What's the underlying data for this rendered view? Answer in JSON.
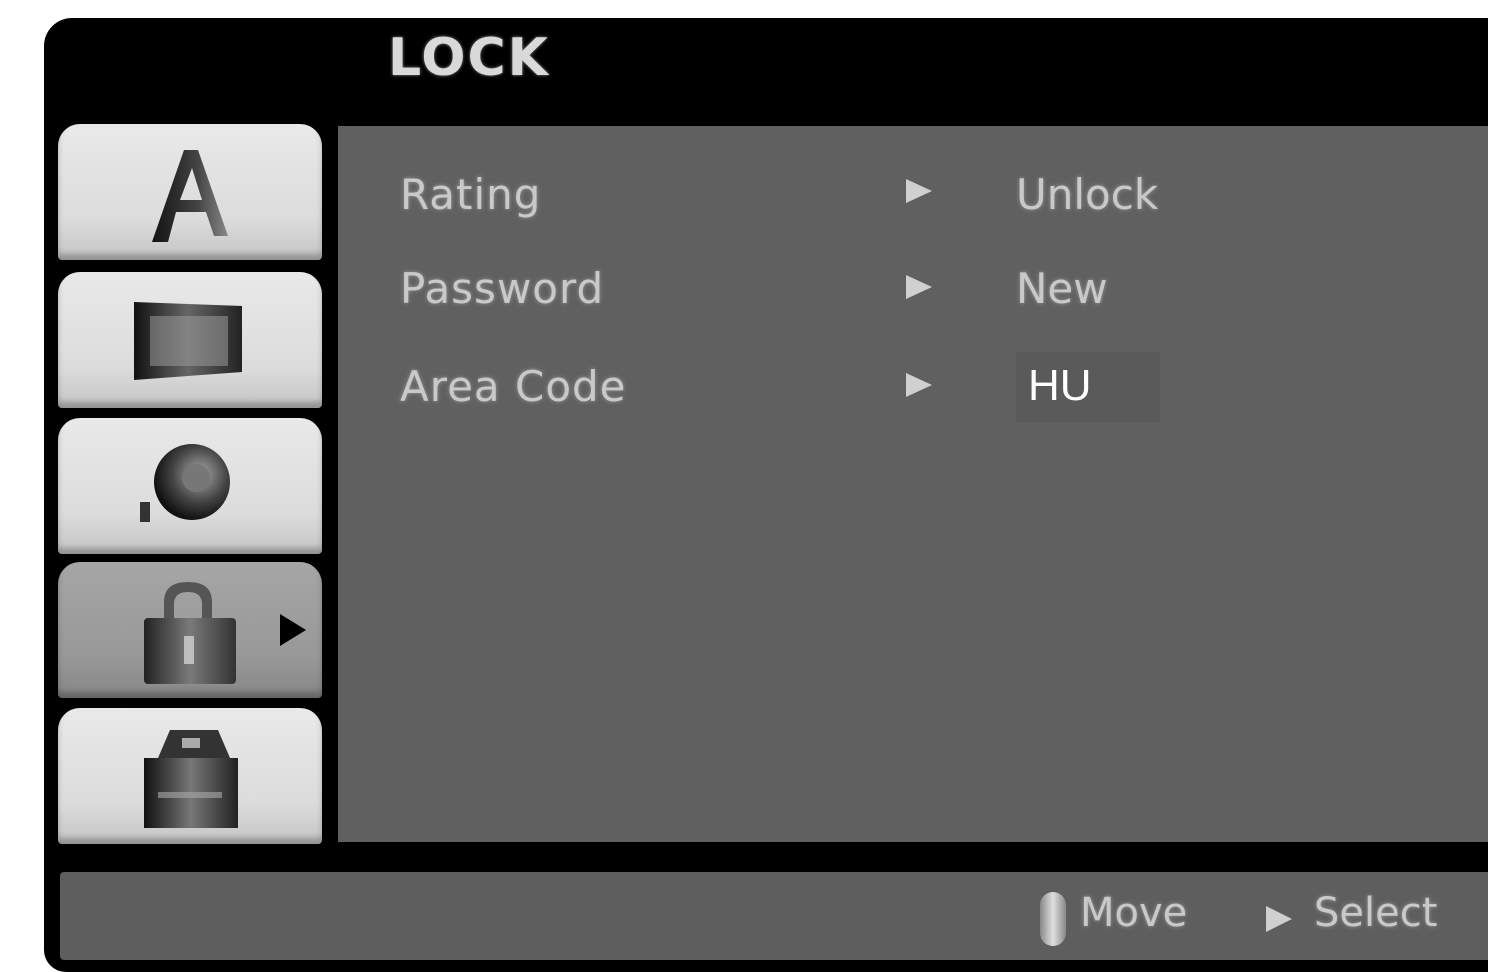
{
  "header": {
    "title": "LOCK"
  },
  "sidebar": {
    "items": [
      {
        "icon": "language-icon",
        "active": false
      },
      {
        "icon": "display-icon",
        "active": false
      },
      {
        "icon": "audio-icon",
        "active": false
      },
      {
        "icon": "lock-icon",
        "active": true
      },
      {
        "icon": "other-settings-icon",
        "active": false
      }
    ],
    "active_indicator_icon": "play-arrow-icon"
  },
  "menu": {
    "rows": [
      {
        "label": "Rating",
        "value": "Unlock"
      },
      {
        "label": "Password",
        "value": "New"
      },
      {
        "label": "Area Code",
        "value": "HU"
      }
    ]
  },
  "footer": {
    "move_label": "Move",
    "select_label": "Select"
  },
  "colors": {
    "frame": "#000000",
    "panel": "#606060",
    "tab": "#dcdcdc",
    "tab_active": "#989898",
    "text": "#c9c9c9",
    "highlight_text": "#ffffff"
  }
}
